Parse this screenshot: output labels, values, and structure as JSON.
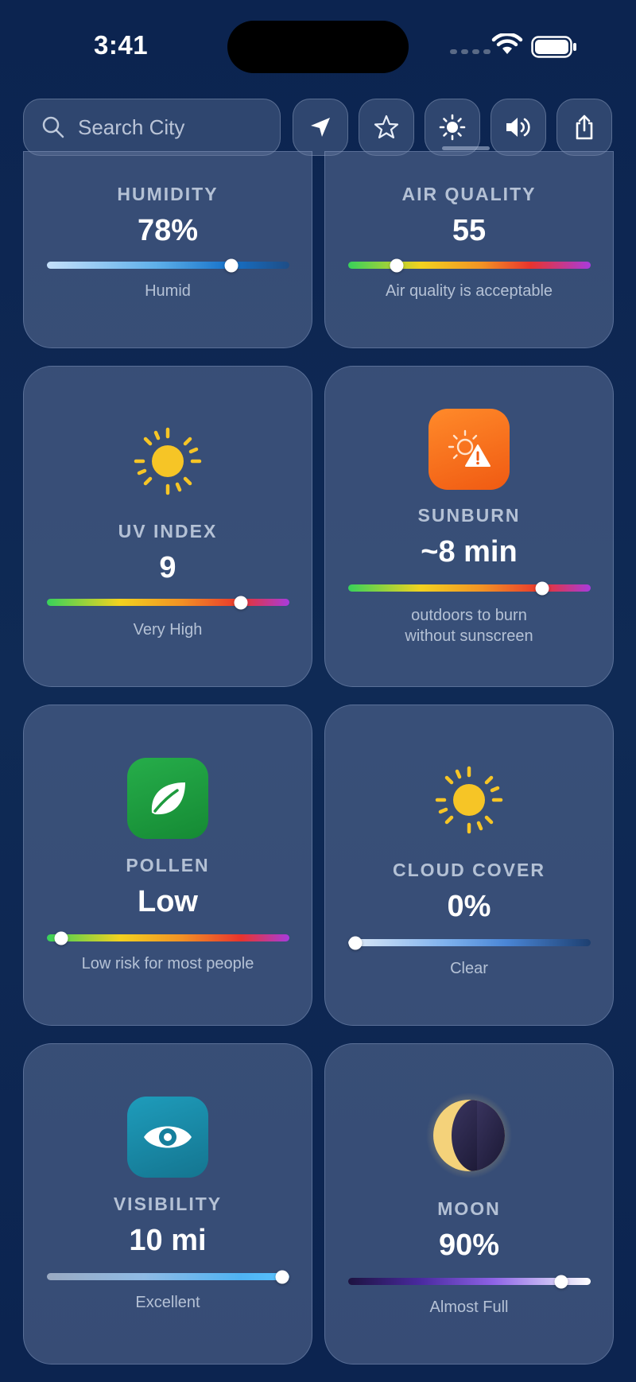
{
  "status": {
    "time": "3:41"
  },
  "search": {
    "placeholder": "Search City"
  },
  "toolbar": {
    "icons": [
      "location-arrow-icon",
      "star-icon",
      "brightness-icon",
      "speaker-icon",
      "share-icon"
    ]
  },
  "cards": {
    "humidity": {
      "title": "HUMIDITY",
      "value": "78%",
      "subtitle": "Humid",
      "level": 0.76
    },
    "air_quality": {
      "title": "AIR QUALITY",
      "value": "55",
      "subtitle": "Air quality is acceptable",
      "level": 0.2
    },
    "uv_index": {
      "title": "UV INDEX",
      "value": "9",
      "subtitle": "Very High",
      "level": 0.8
    },
    "sunburn": {
      "title": "SUNBURN",
      "value": "~8 min",
      "subtitle_line1": "outdoors to burn",
      "subtitle_line2": "without sunscreen",
      "level": 0.8
    },
    "pollen": {
      "title": "POLLEN",
      "value": "Low",
      "subtitle": "Low risk for most people",
      "level": 0.06
    },
    "cloud_cover": {
      "title": "CLOUD COVER",
      "value": "0%",
      "subtitle": "Clear",
      "level": 0.03
    },
    "visibility": {
      "title": "VISIBILITY",
      "value": "10 mi",
      "subtitle": "Excellent",
      "level": 0.97
    },
    "moon": {
      "title": "MOON",
      "value": "90%",
      "subtitle": "Almost Full",
      "level": 0.88
    }
  },
  "colors": {
    "background": "#0f2a55",
    "sunburn_icon": "#f26a1b",
    "pollen_icon": "#1e9a3e",
    "visibility_icon": "#1a8aa8",
    "sun_yellow": "#f6c526"
  }
}
